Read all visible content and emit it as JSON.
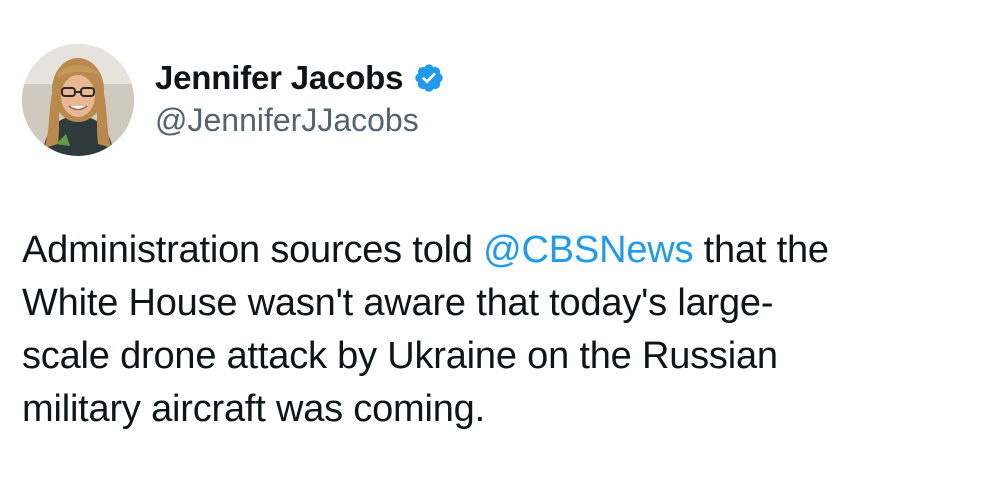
{
  "author": {
    "display_name": "Jennifer Jacobs",
    "handle": "@JenniferJJacobs",
    "verified": true,
    "verified_color": "#1d9bf0"
  },
  "tweet": {
    "line1_before": "Administration sources told ",
    "line1_mention": "@CBSNews",
    "line1_after": " that the",
    "line2": "White House wasn't aware that today's large-",
    "line3": "scale drone attack by Ukraine on the Russian",
    "line4": "military aircraft was coming."
  },
  "colors": {
    "text": "#0f1419",
    "secondary": "#536471",
    "link": "#1d9bf0",
    "background": "#ffffff"
  }
}
